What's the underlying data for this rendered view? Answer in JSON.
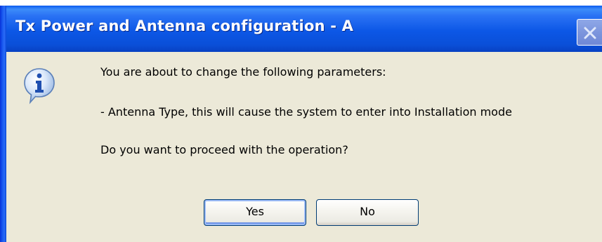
{
  "dialog": {
    "title": "Tx Power and Antenna configuration - A",
    "icon": "information-icon",
    "close_icon": "close-icon",
    "messages": {
      "line1": "You are about to change the following parameters:",
      "line2": " - Antenna Type, this will cause the system to enter into Installation mode",
      "line3": "Do you want to proceed with the operation?"
    },
    "buttons": {
      "yes_label": "Yes",
      "no_label": "No"
    }
  },
  "colors": {
    "titlebar_blue": "#0a4fd8",
    "dialog_background": "#ece9d8",
    "button_border": "#003c74"
  }
}
